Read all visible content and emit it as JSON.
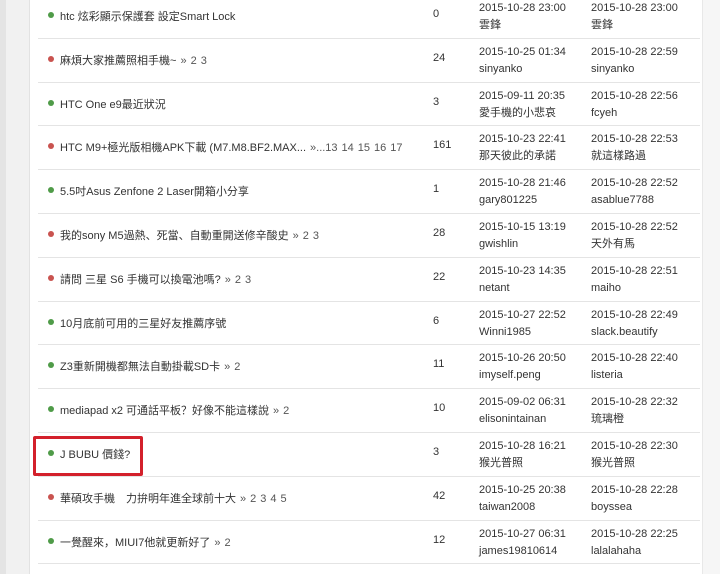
{
  "accent": {
    "normal_dot": "#4f9b48",
    "hot_dot": "#c9534f",
    "highlight": "#d3202b"
  },
  "threads": [
    {
      "status": "normal",
      "title": "htc 炫彩顯示保護套 設定Smart Lock",
      "pages": [],
      "replies": "0",
      "created_time": "2015-10-28 23:00",
      "created_user": "雲鋒",
      "last_time": "2015-10-28 23:00",
      "last_user": "雲鋒"
    },
    {
      "status": "hot",
      "title": "麻煩大家推薦照相手機~",
      "pages": [
        "»",
        "2",
        "3"
      ],
      "replies": "24",
      "created_time": "2015-10-25 01:34",
      "created_user": "sinyanko",
      "last_time": "2015-10-28 22:59",
      "last_user": "sinyanko"
    },
    {
      "status": "normal",
      "title": "HTC One e9最近狀況",
      "pages": [],
      "replies": "3",
      "created_time": "2015-09-11 20:35",
      "created_user": "愛手機的小悲哀",
      "last_time": "2015-10-28 22:56",
      "last_user": "fcyeh"
    },
    {
      "status": "hot",
      "title": "HTC M9+極光版相機APK下載 (M7.M8.BF2.MAX...",
      "pages": [
        "»...13",
        "14",
        "15",
        "16",
        "17"
      ],
      "replies": "161",
      "created_time": "2015-10-23 22:41",
      "created_user": "那天彼此的承諾",
      "last_time": "2015-10-28 22:53",
      "last_user": "就這樣路過"
    },
    {
      "status": "normal",
      "title": "5.5吋Asus Zenfone 2 Laser開箱小分享",
      "pages": [],
      "replies": "1",
      "created_time": "2015-10-28 21:46",
      "created_user": "gary801225",
      "last_time": "2015-10-28 22:52",
      "last_user": "asablue7788"
    },
    {
      "status": "hot",
      "title": "我的sony M5過熱、死當、自動重開送修辛酸史",
      "pages": [
        "»",
        "2",
        "3"
      ],
      "replies": "28",
      "created_time": "2015-10-15 13:19",
      "created_user": "gwishlin",
      "last_time": "2015-10-28 22:52",
      "last_user": "天外有馬"
    },
    {
      "status": "hot",
      "title": "請問 三星 S6 手機可以換電池嗎?",
      "pages": [
        "»",
        "2",
        "3"
      ],
      "replies": "22",
      "created_time": "2015-10-23 14:35",
      "created_user": "netant",
      "last_time": "2015-10-28 22:51",
      "last_user": "maiho"
    },
    {
      "status": "normal",
      "title": "10月底前可用的三星好友推薦序號",
      "pages": [],
      "replies": "6",
      "created_time": "2015-10-27 22:52",
      "created_user": "Winni1985",
      "last_time": "2015-10-28 22:49",
      "last_user": "slack.beautify"
    },
    {
      "status": "normal",
      "title": "Z3重新開機都無法自動掛載SD卡",
      "pages": [
        "»",
        "2"
      ],
      "replies": "11",
      "created_time": "2015-10-26 20:50",
      "created_user": "imyself.peng",
      "last_time": "2015-10-28 22:40",
      "last_user": "listeria"
    },
    {
      "status": "normal",
      "title": "mediapad x2 可通話平板？好像不能這樣說",
      "pages": [
        "»",
        "2"
      ],
      "replies": "10",
      "created_time": "2015-09-02 06:31",
      "created_user": "elisonintainan",
      "last_time": "2015-10-28 22:32",
      "last_user": "琉璃橙"
    },
    {
      "status": "normal",
      "title": "J BUBU 價錢?",
      "pages": [],
      "replies": "3",
      "created_time": "2015-10-28 16:21",
      "created_user": "猴光普照",
      "last_time": "2015-10-28 22:30",
      "last_user": "猴光普照"
    },
    {
      "status": "hot",
      "title": "華碩攻手機　力拚明年進全球前十大",
      "pages": [
        "»",
        "2",
        "3",
        "4",
        "5"
      ],
      "replies": "42",
      "created_time": "2015-10-25 20:38",
      "created_user": "taiwan2008",
      "last_time": "2015-10-28 22:28",
      "last_user": "boyssea"
    },
    {
      "status": "normal",
      "title": "一覺醒來，MIUI7他就更新好了",
      "pages": [
        "»",
        "2"
      ],
      "replies": "12",
      "created_time": "2015-10-27 06:31",
      "created_user": "james19810614",
      "last_time": "2015-10-28 22:25",
      "last_user": "lalalahaha"
    }
  ]
}
